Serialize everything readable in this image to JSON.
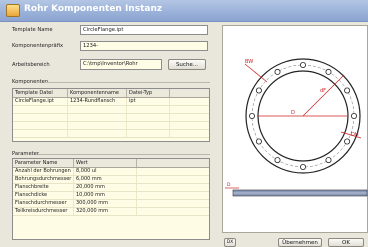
{
  "window": {
    "title": "Rohr Komponenten Instanz"
  },
  "form": {
    "template_label": "Template Name",
    "template_value": "CircleFlange.ipt",
    "prefix_label": "Komponentenpräfix",
    "prefix_value": "1234-",
    "workspace_label": "Arbeitsbereich",
    "workspace_value": "C:\\tmp\\Inventor\\Rohr",
    "search_label": "Suche..."
  },
  "components": {
    "heading": "Komponenten",
    "columns": [
      "Template Datei",
      "Komponentenname",
      "Datei-Typ"
    ],
    "rows": [
      [
        "CircleFlange.ipt",
        "1234-Rundflansch",
        "ipt"
      ]
    ]
  },
  "parameters": {
    "heading": "Parameter",
    "columns": [
      "Parameter Name",
      "Wert"
    ],
    "rows": [
      [
        "Anzahl der Bohrungen",
        "8,000 ul"
      ],
      [
        "Bohrungsdurchmesser",
        "6,000 mm"
      ],
      [
        "Flanschbreite",
        "20,000 mm"
      ],
      [
        "Flanschdicke",
        "10,000 mm"
      ],
      [
        "Flanschdurchmesser",
        "300,000 mm"
      ],
      [
        "Teilkreisdurchmesser",
        "320,000 mm"
      ]
    ]
  },
  "drawing": {
    "dim_labels": {
      "hole": "BW",
      "diameter_d": "D",
      "diameter_df": "dF",
      "bore": "DH"
    },
    "side_label": "D"
  },
  "footer": {
    "small_label": "DX",
    "buttons": [
      "Übernehmen",
      "OK"
    ]
  },
  "colors": {
    "title_bar": "#9bb2da",
    "field_bg": "#fffde6",
    "dimension_red": "#cc2222"
  }
}
